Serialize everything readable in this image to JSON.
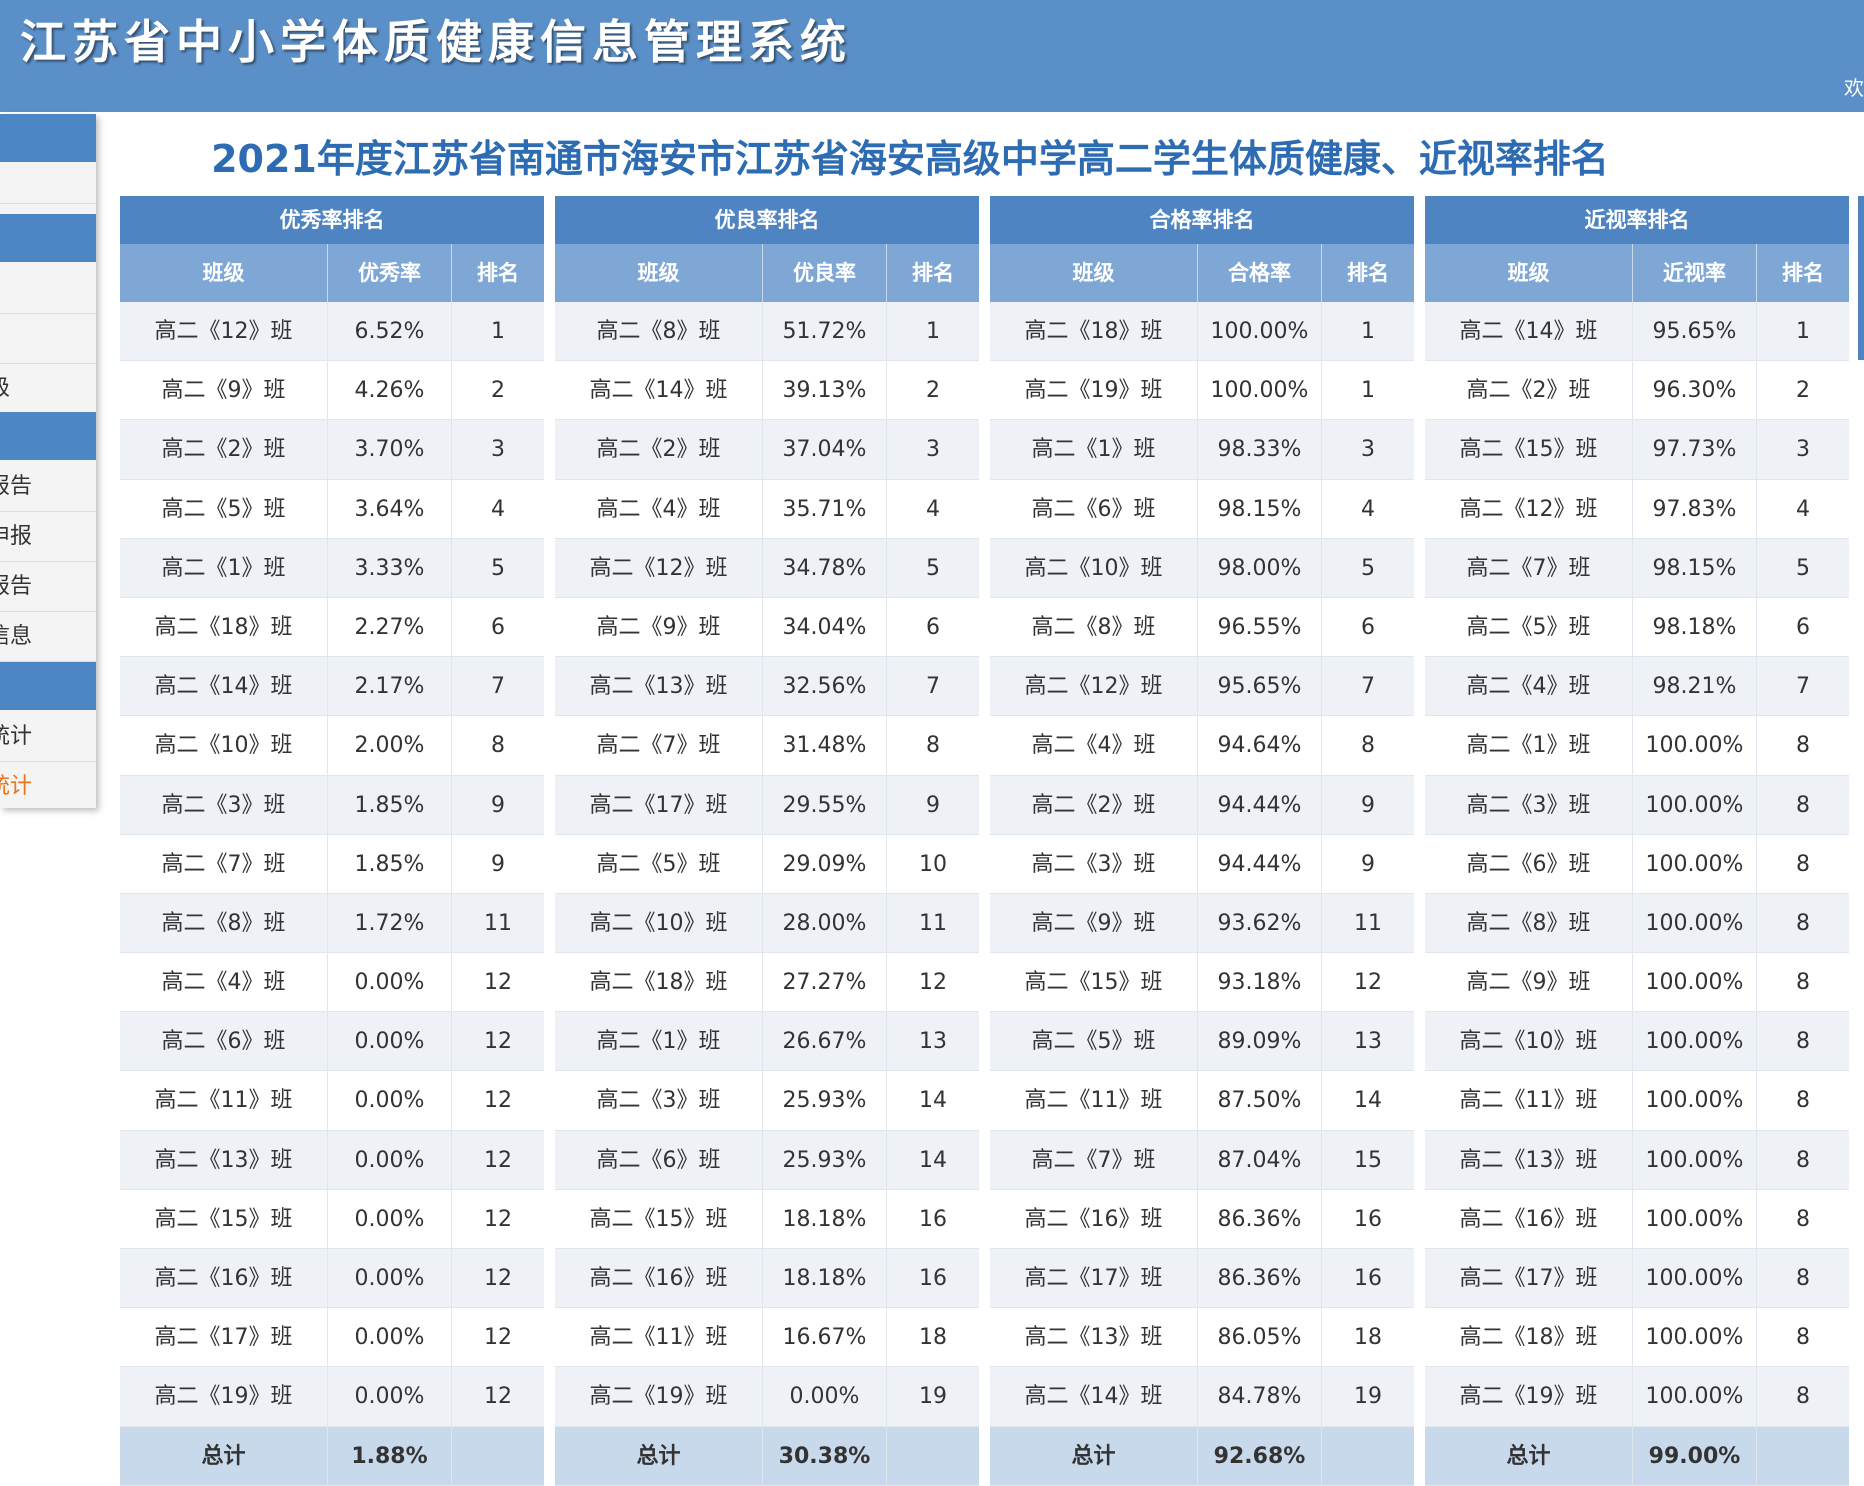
{
  "header": {
    "app_title": "江苏省中小学体质健康信息管理系统",
    "welcome_partial": "欢"
  },
  "sidebar": {
    "links": [
      {
        "label": "级",
        "active": false
      },
      {
        "label": "报告",
        "active": false
      },
      {
        "label": "申报",
        "active": false
      },
      {
        "label": "报告",
        "active": false
      },
      {
        "label": "信息",
        "active": false
      },
      {
        "label": "统计",
        "active": false
      },
      {
        "label": "统计",
        "active": true
      }
    ]
  },
  "main": {
    "page_title": "2021年度江苏省南通市海安市江苏省海安高级中学高二学生体质健康、近视率排名"
  },
  "tables": [
    {
      "title": "优秀率排名",
      "columns": [
        "班级",
        "优秀率",
        "排名"
      ],
      "rows": [
        [
          "高二《12》班",
          "6.52%",
          "1"
        ],
        [
          "高二《9》班",
          "4.26%",
          "2"
        ],
        [
          "高二《2》班",
          "3.70%",
          "3"
        ],
        [
          "高二《5》班",
          "3.64%",
          "4"
        ],
        [
          "高二《1》班",
          "3.33%",
          "5"
        ],
        [
          "高二《18》班",
          "2.27%",
          "6"
        ],
        [
          "高二《14》班",
          "2.17%",
          "7"
        ],
        [
          "高二《10》班",
          "2.00%",
          "8"
        ],
        [
          "高二《3》班",
          "1.85%",
          "9"
        ],
        [
          "高二《7》班",
          "1.85%",
          "9"
        ],
        [
          "高二《8》班",
          "1.72%",
          "11"
        ],
        [
          "高二《4》班",
          "0.00%",
          "12"
        ],
        [
          "高二《6》班",
          "0.00%",
          "12"
        ],
        [
          "高二《11》班",
          "0.00%",
          "12"
        ],
        [
          "高二《13》班",
          "0.00%",
          "12"
        ],
        [
          "高二《15》班",
          "0.00%",
          "12"
        ],
        [
          "高二《16》班",
          "0.00%",
          "12"
        ],
        [
          "高二《17》班",
          "0.00%",
          "12"
        ],
        [
          "高二《19》班",
          "0.00%",
          "12"
        ]
      ],
      "total": [
        "总计",
        "1.88%",
        ""
      ]
    },
    {
      "title": "优良率排名",
      "columns": [
        "班级",
        "优良率",
        "排名"
      ],
      "rows": [
        [
          "高二《8》班",
          "51.72%",
          "1"
        ],
        [
          "高二《14》班",
          "39.13%",
          "2"
        ],
        [
          "高二《2》班",
          "37.04%",
          "3"
        ],
        [
          "高二《4》班",
          "35.71%",
          "4"
        ],
        [
          "高二《12》班",
          "34.78%",
          "5"
        ],
        [
          "高二《9》班",
          "34.04%",
          "6"
        ],
        [
          "高二《13》班",
          "32.56%",
          "7"
        ],
        [
          "高二《7》班",
          "31.48%",
          "8"
        ],
        [
          "高二《17》班",
          "29.55%",
          "9"
        ],
        [
          "高二《5》班",
          "29.09%",
          "10"
        ],
        [
          "高二《10》班",
          "28.00%",
          "11"
        ],
        [
          "高二《18》班",
          "27.27%",
          "12"
        ],
        [
          "高二《1》班",
          "26.67%",
          "13"
        ],
        [
          "高二《3》班",
          "25.93%",
          "14"
        ],
        [
          "高二《6》班",
          "25.93%",
          "14"
        ],
        [
          "高二《15》班",
          "18.18%",
          "16"
        ],
        [
          "高二《16》班",
          "18.18%",
          "16"
        ],
        [
          "高二《11》班",
          "16.67%",
          "18"
        ],
        [
          "高二《19》班",
          "0.00%",
          "19"
        ]
      ],
      "total": [
        "总计",
        "30.38%",
        ""
      ]
    },
    {
      "title": "合格率排名",
      "columns": [
        "班级",
        "合格率",
        "排名"
      ],
      "rows": [
        [
          "高二《18》班",
          "100.00%",
          "1"
        ],
        [
          "高二《19》班",
          "100.00%",
          "1"
        ],
        [
          "高二《1》班",
          "98.33%",
          "3"
        ],
        [
          "高二《6》班",
          "98.15%",
          "4"
        ],
        [
          "高二《10》班",
          "98.00%",
          "5"
        ],
        [
          "高二《8》班",
          "96.55%",
          "6"
        ],
        [
          "高二《12》班",
          "95.65%",
          "7"
        ],
        [
          "高二《4》班",
          "94.64%",
          "8"
        ],
        [
          "高二《2》班",
          "94.44%",
          "9"
        ],
        [
          "高二《3》班",
          "94.44%",
          "9"
        ],
        [
          "高二《9》班",
          "93.62%",
          "11"
        ],
        [
          "高二《15》班",
          "93.18%",
          "12"
        ],
        [
          "高二《5》班",
          "89.09%",
          "13"
        ],
        [
          "高二《11》班",
          "87.50%",
          "14"
        ],
        [
          "高二《7》班",
          "87.04%",
          "15"
        ],
        [
          "高二《16》班",
          "86.36%",
          "16"
        ],
        [
          "高二《17》班",
          "86.36%",
          "16"
        ],
        [
          "高二《13》班",
          "86.05%",
          "18"
        ],
        [
          "高二《14》班",
          "84.78%",
          "19"
        ]
      ],
      "total": [
        "总计",
        "92.68%",
        ""
      ]
    },
    {
      "title": "近视率排名",
      "columns": [
        "班级",
        "近视率",
        "排名"
      ],
      "rows": [
        [
          "高二《14》班",
          "95.65%",
          "1"
        ],
        [
          "高二《2》班",
          "96.30%",
          "2"
        ],
        [
          "高二《15》班",
          "97.73%",
          "3"
        ],
        [
          "高二《12》班",
          "97.83%",
          "4"
        ],
        [
          "高二《7》班",
          "98.15%",
          "5"
        ],
        [
          "高二《5》班",
          "98.18%",
          "6"
        ],
        [
          "高二《4》班",
          "98.21%",
          "7"
        ],
        [
          "高二《1》班",
          "100.00%",
          "8"
        ],
        [
          "高二《3》班",
          "100.00%",
          "8"
        ],
        [
          "高二《6》班",
          "100.00%",
          "8"
        ],
        [
          "高二《8》班",
          "100.00%",
          "8"
        ],
        [
          "高二《9》班",
          "100.00%",
          "8"
        ],
        [
          "高二《10》班",
          "100.00%",
          "8"
        ],
        [
          "高二《11》班",
          "100.00%",
          "8"
        ],
        [
          "高二《13》班",
          "100.00%",
          "8"
        ],
        [
          "高二《16》班",
          "100.00%",
          "8"
        ],
        [
          "高二《17》班",
          "100.00%",
          "8"
        ],
        [
          "高二《18》班",
          "100.00%",
          "8"
        ],
        [
          "高二《19》班",
          "100.00%",
          "8"
        ]
      ],
      "total": [
        "总计",
        "99.00%",
        ""
      ]
    }
  ],
  "colors": {
    "header_bg": "#5b8fc7",
    "table_header": "#4f84c2",
    "table_subheader": "#7ea7d6",
    "title_text": "#2d6bb3",
    "active_link": "#e8741c"
  }
}
